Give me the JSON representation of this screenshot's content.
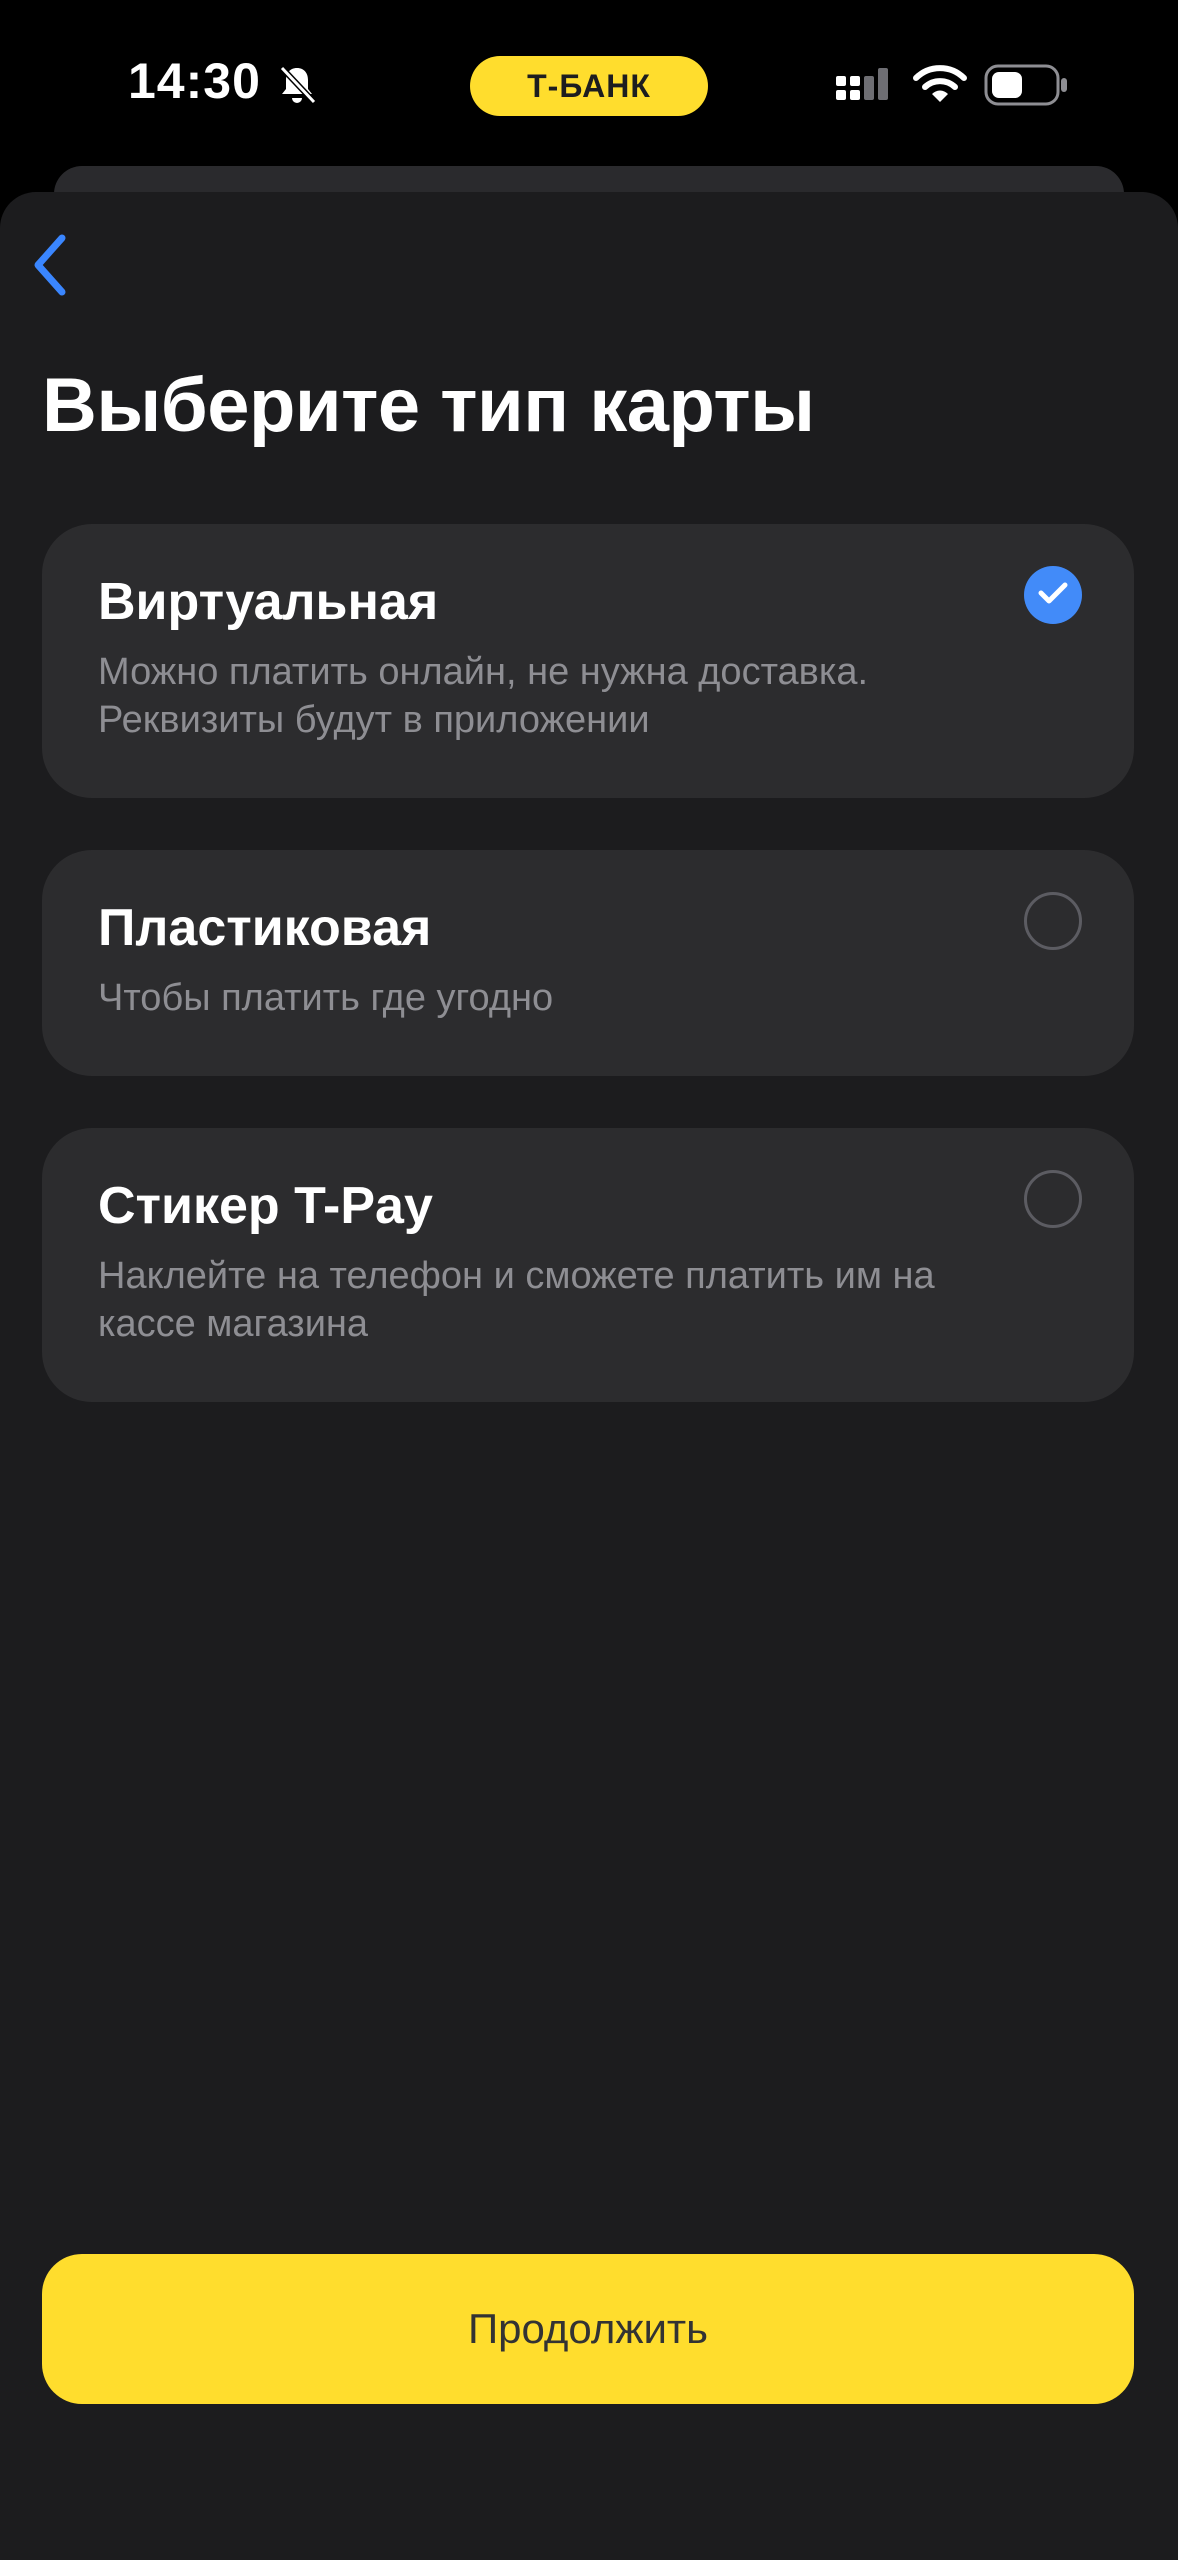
{
  "status_bar": {
    "time": "14:30",
    "brand": "Т-БАНК",
    "icons": [
      "bell-slash-icon",
      "cellular-signal-icon",
      "wifi-icon",
      "battery-icon"
    ]
  },
  "nav": {
    "back_icon": "chevron-left-icon"
  },
  "page": {
    "title": "Выберите тип карты"
  },
  "options": [
    {
      "title": "Виртуальная",
      "description": "Можно платить онлайн, не нужна доставка. Реквизиты будут в приложении",
      "selected": true
    },
    {
      "title": "Пластиковая",
      "description": "Чтобы платить где угодно",
      "selected": false
    },
    {
      "title": "Стикер T-Pay",
      "description": "Наклейте на телефон и сможете платить им на кассе магазина",
      "selected": false
    }
  ],
  "footer": {
    "continue_label": "Продолжить"
  },
  "colors": {
    "background": "#1c1c1e",
    "card": "#2c2c2e",
    "accent_yellow": "#ffdd2d",
    "accent_blue": "#428bf9",
    "secondary_text": "#8e8e93"
  }
}
